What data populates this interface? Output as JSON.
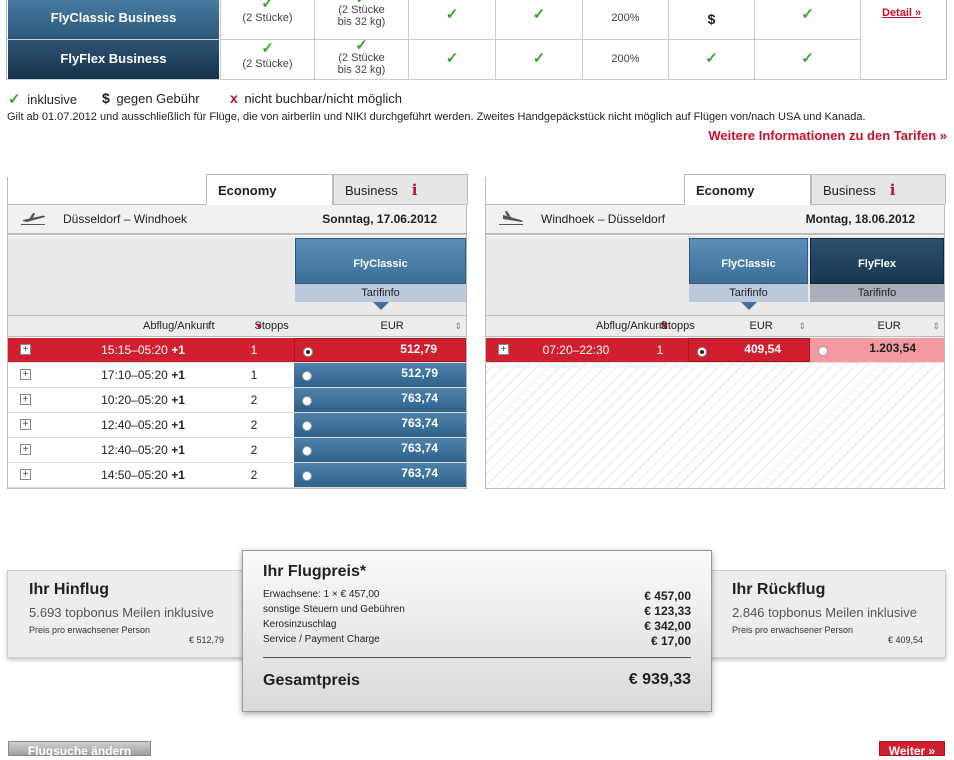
{
  "tariff_table": {
    "rows": [
      {
        "name": "FlyClassic Business",
        "col1_check": "✓",
        "col1_text": "(2 Stücke)",
        "col2_check": "✓",
        "col2_text1": "(2 Stücke",
        "col2_text2": "bis 32 kg)",
        "col3": "✓",
        "col4": "✓",
        "col5": "200%",
        "col6": "$",
        "col7": "✓"
      },
      {
        "name": "FlyFlex Business",
        "col1_check": "✓",
        "col1_text": "(2 Stücke)",
        "col2_check": "✓",
        "col2_text1": "(2 Stücke",
        "col2_text2": "bis 32 kg)",
        "col3": "✓",
        "col4": "✓",
        "col5": "200%",
        "col6": "✓",
        "col7": "✓"
      }
    ],
    "detail_link": "Detail »"
  },
  "legend": {
    "inclusive_icon": "✓",
    "inclusive": "inklusive",
    "fee_icon": "$",
    "fee": "gegen Gebühr",
    "na_icon": "x",
    "na": "nicht buchbar/nicht möglich"
  },
  "note": "Gilt ab 01.07.2012 und ausschließlich für Flüge, die von airberlin und NIKI durchgeführt werden. Zweites Handgepäckstück nicht möglich auf Flügen von/nach USA und Kanada.",
  "more_info": "Weitere Informationen zu den Tarifen »",
  "outbound": {
    "tab_economy": "Economy",
    "tab_business": "Business",
    "info_icon": "i",
    "route": "Düsseldorf – Windhoek",
    "date": "Sonntag, 17.06.2012",
    "fare_name": "FlyClassic",
    "fare_info": "Tarifinfo",
    "col_dep": "Abflug/Ankunft",
    "col_stops": "Stopps",
    "col_cur": "EUR",
    "flights": [
      {
        "time": "15:15–05:20",
        "plus": "+1",
        "stops": "1",
        "price": "512,79"
      },
      {
        "time": "17:10–05:20",
        "plus": "+1",
        "stops": "1",
        "price": "512,79"
      },
      {
        "time": "10:20–05:20",
        "plus": "+1",
        "stops": "2",
        "price": "763,74"
      },
      {
        "time": "12:40–05:20",
        "plus": "+1",
        "stops": "2",
        "price": "763,74"
      },
      {
        "time": "12:40–05:20",
        "plus": "+1",
        "stops": "2",
        "price": "763,74"
      },
      {
        "time": "14:50–05:20",
        "plus": "+1",
        "stops": "2",
        "price": "763,74"
      }
    ]
  },
  "return": {
    "tab_economy": "Economy",
    "tab_business": "Business",
    "info_icon": "i",
    "route": "Windhoek – Düsseldorf",
    "date": "Montag, 18.06.2012",
    "fare1": "FlyClassic",
    "fare2": "FlyFlex",
    "fare_info": "Tarifinfo",
    "col_dep": "Abflug/Ankunft",
    "col_stops": "Stopps",
    "col_cur1": "EUR",
    "col_cur2": "EUR",
    "flight": {
      "time": "07:20–22:30",
      "stops": "1",
      "price1": "409,54",
      "price2": "1.203,54"
    }
  },
  "summary": {
    "outbound_title": "Ihr Hinflug",
    "outbound_miles": "5.693 topbonus Meilen inklusive",
    "outbound_per": "Preis pro erwachsener Person",
    "outbound_amount": "€ 512,79",
    "return_title": "Ihr Rückflug",
    "return_miles": "2.846 topbonus Meilen inklusive",
    "return_per": "Preis pro erwachsener Person",
    "return_amount": "€ 409,54",
    "price_title": "Ihr Flugpreis*",
    "lines": [
      {
        "label": "Erwachsene: 1 × € 457,00",
        "value": "€ 457,00"
      },
      {
        "label": "sonstige Steuern und Gebühren",
        "value": "€ 123,33"
      },
      {
        "label": "Kerosinzuschlag",
        "value": "€ 342,00"
      },
      {
        "label": "Service / Payment Charge",
        "value": "€ 17,00"
      }
    ],
    "total_label": "Gesamtpreis",
    "total_value": "€ 939,33"
  },
  "buttons": {
    "change": "Flugsuche ändern",
    "next": "Weiter »"
  }
}
